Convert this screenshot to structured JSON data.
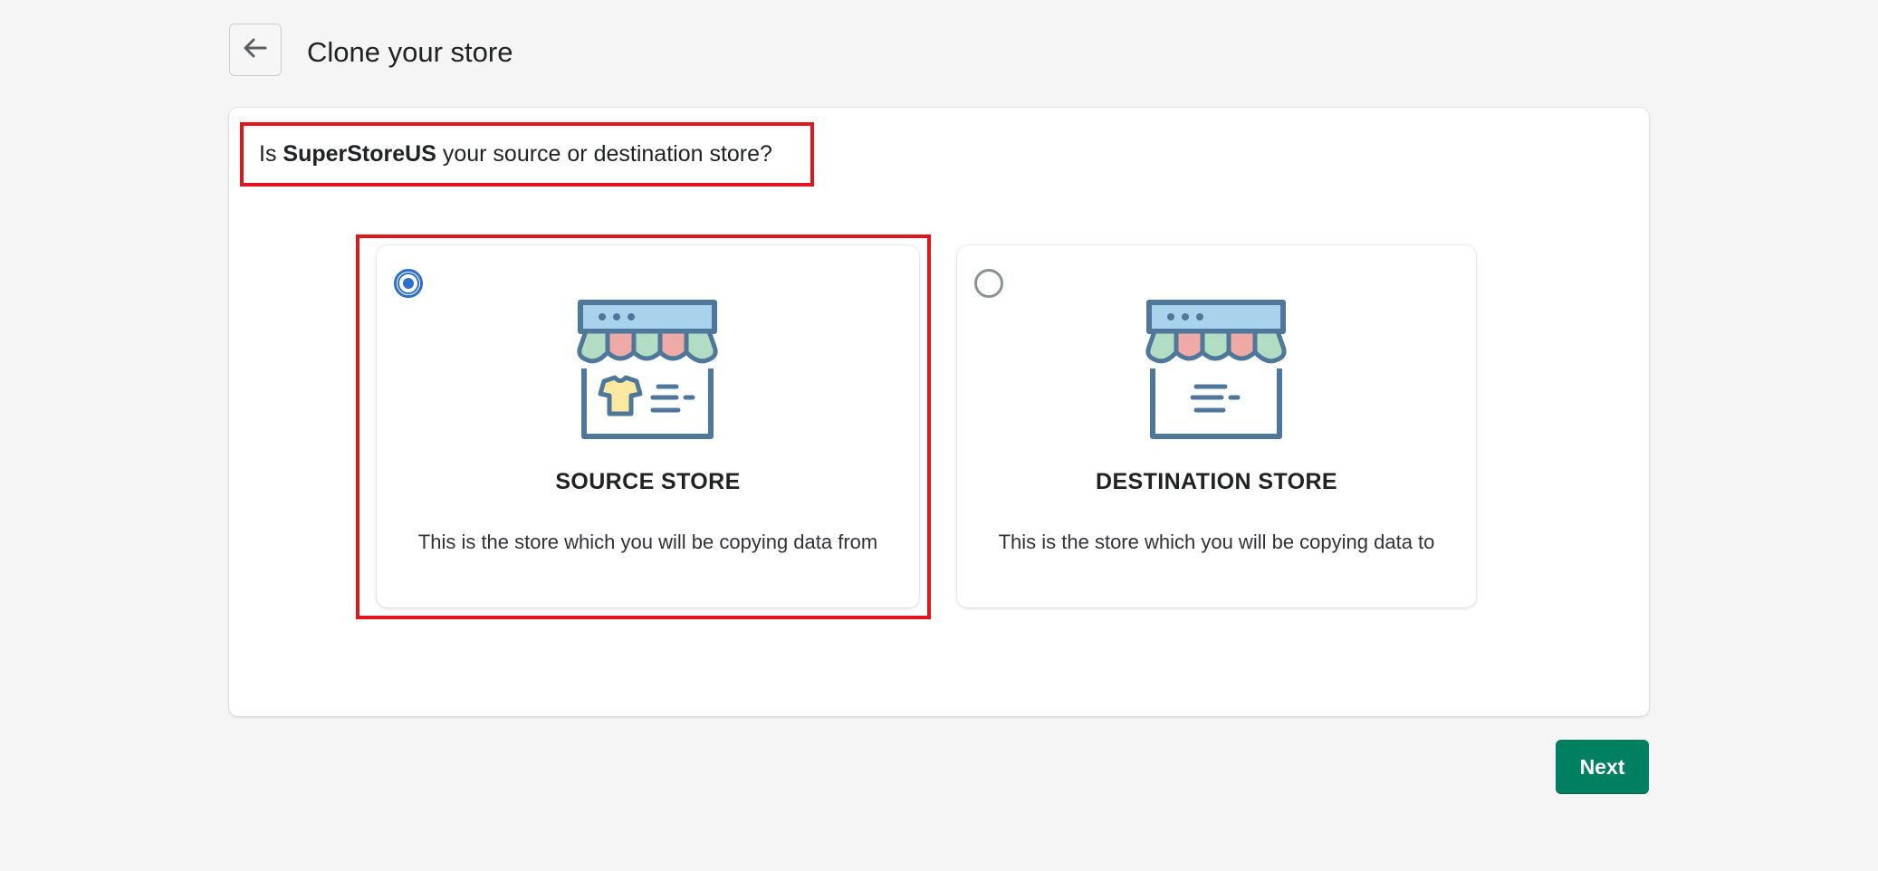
{
  "header": {
    "back_icon": "arrow-left-icon",
    "title": "Clone your store"
  },
  "question": {
    "prefix": "Is ",
    "store_name": "SuperStoreUS",
    "suffix": " your source or destination store?"
  },
  "options": [
    {
      "title": "SOURCE STORE",
      "description": "This is the store which you will be copying data from",
      "selected": true,
      "icon": "storefront-with-product-icon"
    },
    {
      "title": "DESTINATION STORE",
      "description": "This is the store which you will be copying data to",
      "selected": false,
      "icon": "storefront-empty-icon"
    }
  ],
  "actions": {
    "next_label": "Next"
  },
  "colors": {
    "accent": "#2c6ecb",
    "primary_button": "#008060",
    "highlight": "#e0161f",
    "icon_stroke": "#4f7799",
    "awning_blue": "#a9d3ec",
    "awning_pink": "#eeaaa6",
    "awning_green": "#b3dcc4",
    "shirt_yellow": "#fbe9a1"
  }
}
